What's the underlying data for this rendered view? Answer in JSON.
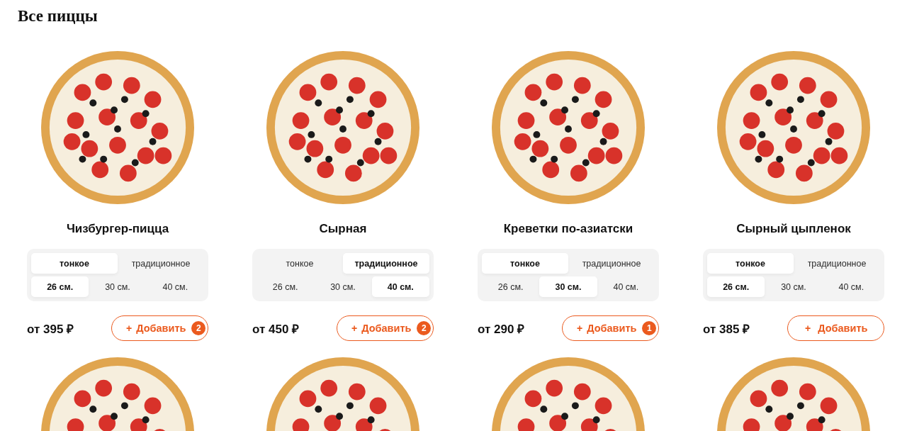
{
  "heading": "Все пиццы",
  "pizzas": [
    {
      "name": "Чизбургер-пицца",
      "doughs": [
        {
          "label": "тонкое",
          "selected": true
        },
        {
          "label": "традиционное",
          "selected": false
        }
      ],
      "sizes": [
        {
          "label": "26 см.",
          "selected": true
        },
        {
          "label": "30 см.",
          "selected": false
        },
        {
          "label": "40 см.",
          "selected": false
        }
      ],
      "price": "от 395 ₽",
      "button": {
        "plus": "+",
        "label": "Добавить",
        "count": "2"
      }
    },
    {
      "name": "Сырная",
      "doughs": [
        {
          "label": "тонкое",
          "selected": false
        },
        {
          "label": "традиционное",
          "selected": true
        }
      ],
      "sizes": [
        {
          "label": "26 см.",
          "selected": false
        },
        {
          "label": "30 см.",
          "selected": false
        },
        {
          "label": "40 см.",
          "selected": true
        }
      ],
      "price": "от 450 ₽",
      "button": {
        "plus": "+",
        "label": "Добавить",
        "count": "2"
      }
    },
    {
      "name": "Креветки по-азиатски",
      "doughs": [
        {
          "label": "тонкое",
          "selected": true
        },
        {
          "label": "традиционное",
          "selected": false
        }
      ],
      "sizes": [
        {
          "label": "26 см.",
          "selected": false
        },
        {
          "label": "30 см.",
          "selected": true
        },
        {
          "label": "40 см.",
          "selected": false
        }
      ],
      "price": "от 290 ₽",
      "button": {
        "plus": "+",
        "label": "Добавить",
        "count": "1"
      }
    },
    {
      "name": "Сырный цыпленок",
      "doughs": [
        {
          "label": "тонкое",
          "selected": true
        },
        {
          "label": "традиционное",
          "selected": false
        }
      ],
      "sizes": [
        {
          "label": "26 см.",
          "selected": true
        },
        {
          "label": "30 см.",
          "selected": false
        },
        {
          "label": "40 см.",
          "selected": false
        }
      ],
      "price": "от 385 ₽",
      "button": {
        "plus": "+",
        "label": "Добавить"
      }
    }
  ],
  "next_row": [
    {
      "kind": "photo"
    },
    {
      "kind": "photo"
    },
    {
      "kind": "photo"
    },
    {
      "kind": "photo"
    }
  ]
}
